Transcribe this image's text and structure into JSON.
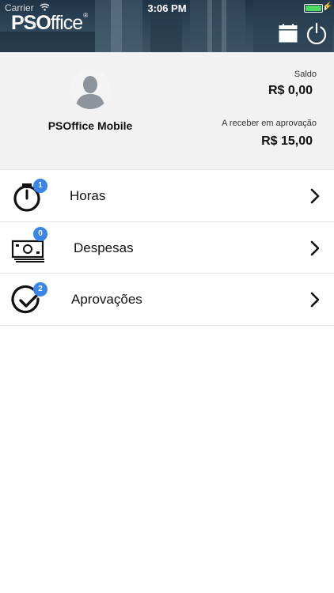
{
  "status_bar": {
    "carrier": "Carrier",
    "time": "3:06 PM",
    "battery_level_percent": 100,
    "battery_color": "#4cd964"
  },
  "header": {
    "logo_bold": "PSO",
    "logo_regular": "ffice",
    "logo_mark": "®",
    "icons": [
      "calendar-icon",
      "power-icon"
    ]
  },
  "profile": {
    "user_name": "PSOffice Mobile",
    "saldo_label": "Saldo",
    "saldo_value": "R$ 0,00",
    "receber_label": "A receber em aprovação",
    "receber_value": "R$ 15,00"
  },
  "menu": {
    "badge_color": "#3a86e8",
    "items": [
      {
        "label": "Horas",
        "badge": "1",
        "icon": "stopwatch-icon"
      },
      {
        "label": "Despesas",
        "badge": "0",
        "icon": "cash-icon"
      },
      {
        "label": "Aprovações",
        "badge": "2",
        "icon": "check-circle-icon"
      }
    ]
  }
}
